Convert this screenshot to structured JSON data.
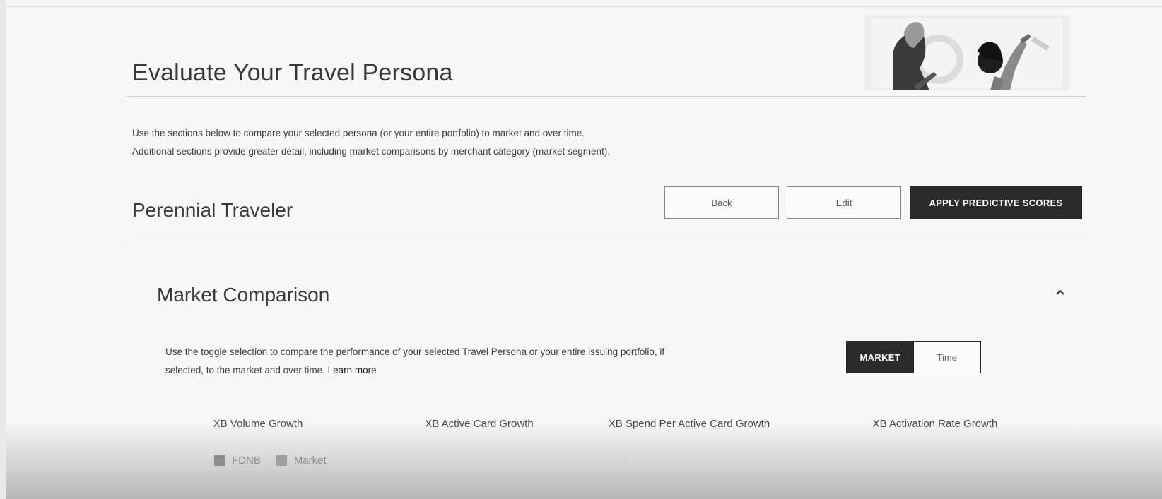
{
  "header": {
    "title": "Evaluate Your Travel Persona"
  },
  "intro": {
    "line1": "Use the sections below to compare your selected persona (or your entire portfolio) to market and over time.",
    "line2": "Additional sections provide greater detail, including market comparisons by merchant category (market segment)."
  },
  "persona": {
    "name": "Perennial Traveler",
    "back_label": "Back",
    "edit_label": "Edit",
    "apply_label": "APPLY PREDICTIVE SCORES"
  },
  "market_comparison": {
    "title": "Market Comparison",
    "description_line1": "Use the toggle selection to compare the performance of your selected Travel Persona or your entire issuing portfolio, if",
    "description_line2": "selected, to the market and over time.",
    "learn_more": "Learn more",
    "toggle": {
      "options": [
        "MARKET",
        "Time"
      ],
      "selected": "MARKET"
    },
    "metrics": [
      "XB Volume Growth",
      "XB Active Card Growth",
      "XB Spend Per Active Card Growth",
      "XB Activation Rate Growth"
    ],
    "legend": [
      {
        "label": "FDNB",
        "color": "#3a3a3a"
      },
      {
        "label": "Market",
        "color": "#6a6a6a"
      }
    ]
  },
  "colors": {
    "primary_dark": "#2b2b2b",
    "background": "#f7f7f7"
  }
}
